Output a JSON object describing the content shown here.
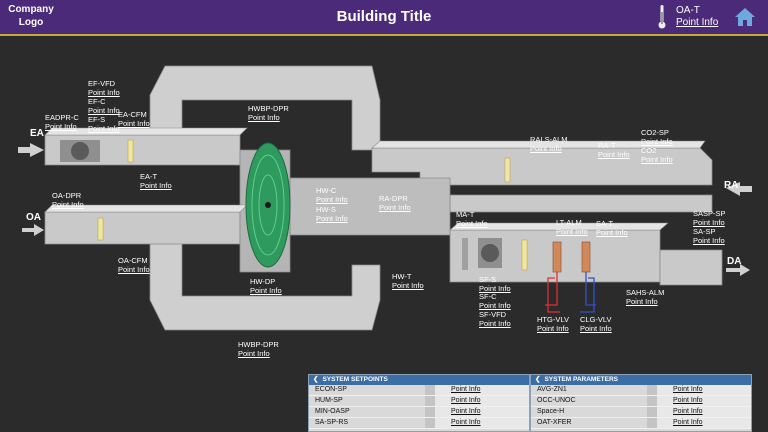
{
  "header": {
    "logo_line1": "Company",
    "logo_line2": "Logo",
    "title": "Building Title",
    "oat_label": "OA-T",
    "oat_link": "Point Info"
  },
  "flows": {
    "ea": "EA",
    "oa": "OA",
    "ra": "RA",
    "da": "DA"
  },
  "points": {
    "ef_vfd": {
      "name": "EF-VFD",
      "link": "Point Info"
    },
    "ef_c": {
      "name": "EF-C",
      "link": "Point Info"
    },
    "ef_s": {
      "name": "EF-S",
      "link": "Point Info"
    },
    "ea_cfm": {
      "name": "EA-CFM",
      "link": "Point Info"
    },
    "eadpr_c": {
      "name": "EADPR-C",
      "link": "Point Info"
    },
    "ea_t": {
      "name": "EA-T",
      "link": "Point Info"
    },
    "hwbp_dpr_top": {
      "name": "HWBP-DPR",
      "link": "Point Info"
    },
    "oa_dpr": {
      "name": "OA-DPR",
      "link": "Point Info"
    },
    "oa_cfm": {
      "name": "OA-CFM",
      "link": "Point Info"
    },
    "hw_c": {
      "name": "HW-C",
      "link": "Point Info"
    },
    "hw_s": {
      "name": "HW-S",
      "link": "Point Info"
    },
    "ra_dpr": {
      "name": "RA-DPR",
      "link": "Point Info"
    },
    "hw_dp": {
      "name": "HW-DP",
      "link": "Point Info"
    },
    "hwbp_dpr_bot": {
      "name": "HWBP-DPR",
      "link": "Point Info"
    },
    "hw_t": {
      "name": "HW-T",
      "link": "Point Info"
    },
    "rals_alm": {
      "name": "RALS-ALM",
      "link": "Point Info"
    },
    "ra_t": {
      "name": "RA-T",
      "link": "Point Info"
    },
    "co2_sp": {
      "name": "CO2-SP",
      "link": "Point Info"
    },
    "co2": {
      "name": "CO2",
      "link": "Point Info"
    },
    "ma_t": {
      "name": "MA-T",
      "link": "Point Info"
    },
    "lt_alm": {
      "name": "LT-ALM",
      "link": "Point Info"
    },
    "sa_t": {
      "name": "SA-T",
      "link": "Point Info"
    },
    "sasp_sp": {
      "name": "SASP-SP",
      "link": "Point Info"
    },
    "sa_sp": {
      "name": "SA-SP",
      "link": "Point Info"
    },
    "sf_s": {
      "name": "SF-S",
      "link": "Point Info"
    },
    "sf_c": {
      "name": "SF-C",
      "link": "Point Info"
    },
    "sf_vfd": {
      "name": "SF-VFD",
      "link": "Point Info"
    },
    "htg_vlv": {
      "name": "HTG-VLV",
      "link": "Point Info"
    },
    "clg_vlv": {
      "name": "CLG-VLV",
      "link": "Point Info"
    },
    "sahs_alm": {
      "name": "SAHS-ALM",
      "link": "Point Info"
    }
  },
  "setpoints_panel": {
    "title": "SYSTEM SETPOINTS",
    "rows": [
      {
        "name": "ECON-SP",
        "link": "Point Info"
      },
      {
        "name": "HUM-SP",
        "link": "Point Info"
      },
      {
        "name": "MIN-OASP",
        "link": "Point Info"
      },
      {
        "name": "SA-SP-RS",
        "link": "Point Info"
      }
    ]
  },
  "parameters_panel": {
    "title": "SYSTEM PARAMETERS",
    "rows": [
      {
        "name": "AVG-ZN1",
        "link": "Point Info"
      },
      {
        "name": "OCC-UNOC",
        "link": "Point Info"
      },
      {
        "name": "Space-H",
        "link": "Point Info"
      },
      {
        "name": "OAT-XFER",
        "link": "Point Info"
      }
    ]
  },
  "colors": {
    "header": "#4b2a7a",
    "accent_line": "#c8a838",
    "panel_header": "#3a6ea5",
    "duct": "#c9c9c9",
    "wheel": "#2e9a5e"
  }
}
